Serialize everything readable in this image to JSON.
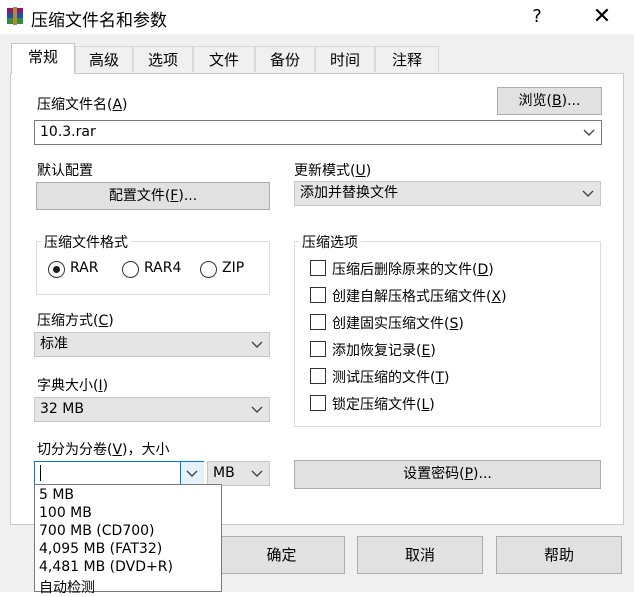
{
  "window": {
    "title": "压缩文件名和参数",
    "help": "?",
    "close": "✕"
  },
  "tabs": [
    "常规",
    "高级",
    "选项",
    "文件",
    "备份",
    "时间",
    "注释"
  ],
  "archive_name": {
    "label": "压缩文件名(",
    "hotkey": "A",
    "label_end": ")",
    "value": "10.3.rar",
    "browse": "浏览(",
    "browse_hotkey": "B",
    "browse_end": ")..."
  },
  "default_profile": {
    "label": "默认配置",
    "button": "配置文件(",
    "hotkey": "F",
    "button_end": ")..."
  },
  "update_mode": {
    "label": "更新模式(",
    "hotkey": "U",
    "label_end": ")",
    "value": "添加并替换文件"
  },
  "format": {
    "title": "压缩文件格式",
    "options": [
      "RAR",
      "RAR4",
      "ZIP"
    ],
    "selected": "RAR"
  },
  "method": {
    "label": "压缩方式(",
    "hotkey": "C",
    "label_end": ")",
    "value": "标准"
  },
  "dict_size": {
    "label": "字典大小(",
    "hotkey": "I",
    "label_end": ")",
    "value": "32 MB"
  },
  "split": {
    "label": "切分为分卷(",
    "hotkey": "V",
    "label_end": ")，大小",
    "value": "",
    "unit": "MB",
    "options": [
      "5 MB",
      "100 MB",
      "700 MB  (CD700)",
      "4,095 MB  (FAT32)",
      "4,481 MB  (DVD+R)",
      "自动检测"
    ]
  },
  "archive_options": {
    "title": "压缩选项",
    "items": [
      {
        "label": "压缩后删除原来的文件(",
        "hotkey": "D",
        "end": ")"
      },
      {
        "label": "创建自解压格式压缩文件(",
        "hotkey": "X",
        "end": ")"
      },
      {
        "label": "创建固实压缩文件(",
        "hotkey": "S",
        "end": ")"
      },
      {
        "label": "添加恢复记录(",
        "hotkey": "E",
        "end": ")"
      },
      {
        "label": "测试压缩的文件(",
        "hotkey": "T",
        "end": ")"
      },
      {
        "label": "锁定压缩文件(",
        "hotkey": "L",
        "end": ")"
      }
    ]
  },
  "password": {
    "button": "设置密码(",
    "hotkey": "P",
    "button_end": ")..."
  },
  "footer": {
    "ok": "确定",
    "cancel": "取消",
    "help": "帮助"
  }
}
